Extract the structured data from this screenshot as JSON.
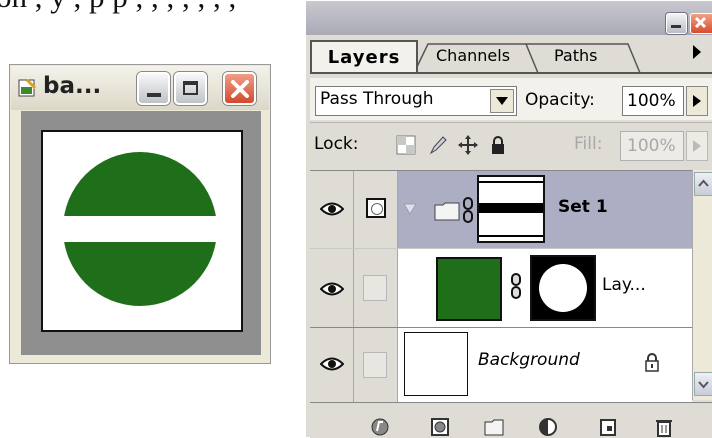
{
  "top_text": "on ,   y    ,   p   p   ,   ,   ,   ,     ,   ,   ,",
  "document_window": {
    "title": "ba...",
    "icon": "document-icon",
    "shape_color": "#1f6e1a",
    "controls": {
      "minimize": "minimize-icon",
      "maximize": "maximize-icon",
      "close": "close-icon"
    }
  },
  "layers_panel": {
    "tabs": [
      {
        "label": "Layers",
        "active": true
      },
      {
        "label": "Channels",
        "active": false
      },
      {
        "label": "Paths",
        "active": false
      }
    ],
    "blend_mode": "Pass Through",
    "opacity_label": "Opacity:",
    "opacity_value": "100%",
    "lock_label": "Lock:",
    "fill_label": "Fill:",
    "fill_value": "100%",
    "layers": [
      {
        "name": "Set 1",
        "type": "group",
        "visible": true,
        "selected": true
      },
      {
        "name": "Lay...",
        "type": "layer",
        "visible": true,
        "color": "#1f6e1a"
      },
      {
        "name": "Background",
        "type": "background",
        "visible": true,
        "locked": true
      }
    ],
    "bottom_icons": [
      "layer-style-icon",
      "add-mask-icon",
      "new-set-icon",
      "adjustment-layer-icon",
      "new-layer-icon",
      "trash-icon"
    ]
  }
}
